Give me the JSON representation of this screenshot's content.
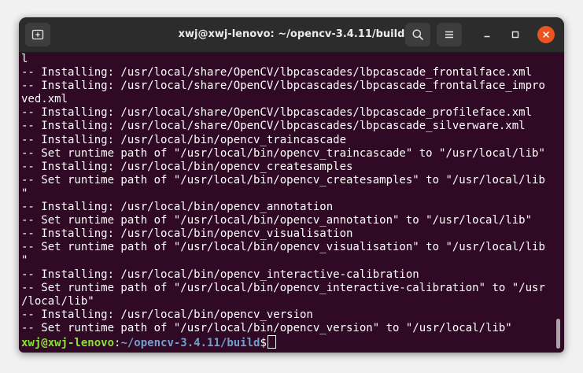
{
  "window": {
    "title": "xwj@xwj-lenovo: ~/opencv-3.4.11/build"
  },
  "icons": {
    "new_tab": "new-tab-icon",
    "search": "search-icon",
    "menu": "hamburger-menu-icon",
    "minimize": "minimize-icon",
    "maximize": "maximize-icon",
    "close": "close-icon"
  },
  "colors": {
    "terminal_bg": "#300a24",
    "titlebar_bg": "#2c2c2c",
    "close_button": "#e95420",
    "prompt_user": "#8ae234",
    "prompt_path": "#729fcf"
  },
  "terminal": {
    "lines": [
      "l",
      "-- Installing: /usr/local/share/OpenCV/lbpcascades/lbpcascade_frontalface.xml",
      "-- Installing: /usr/local/share/OpenCV/lbpcascades/lbpcascade_frontalface_impro",
      "ved.xml",
      "-- Installing: /usr/local/share/OpenCV/lbpcascades/lbpcascade_profileface.xml",
      "-- Installing: /usr/local/share/OpenCV/lbpcascades/lbpcascade_silverware.xml",
      "-- Installing: /usr/local/bin/opencv_traincascade",
      "-- Set runtime path of \"/usr/local/bin/opencv_traincascade\" to \"/usr/local/lib\"",
      "-- Installing: /usr/local/bin/opencv_createsamples",
      "-- Set runtime path of \"/usr/local/bin/opencv_createsamples\" to \"/usr/local/lib",
      "\"",
      "-- Installing: /usr/local/bin/opencv_annotation",
      "-- Set runtime path of \"/usr/local/bin/opencv_annotation\" to \"/usr/local/lib\"",
      "-- Installing: /usr/local/bin/opencv_visualisation",
      "-- Set runtime path of \"/usr/local/bin/opencv_visualisation\" to \"/usr/local/lib",
      "\"",
      "-- Installing: /usr/local/bin/opencv_interactive-calibration",
      "-- Set runtime path of \"/usr/local/bin/opencv_interactive-calibration\" to \"/usr",
      "/local/lib\"",
      "-- Installing: /usr/local/bin/opencv_version",
      "-- Set runtime path of \"/usr/local/bin/opencv_version\" to \"/usr/local/lib\""
    ],
    "prompt": {
      "user_host": "xwj@xwj-lenovo",
      "separator": ":",
      "path": "~/opencv-3.4.11/build",
      "symbol": "$"
    }
  }
}
